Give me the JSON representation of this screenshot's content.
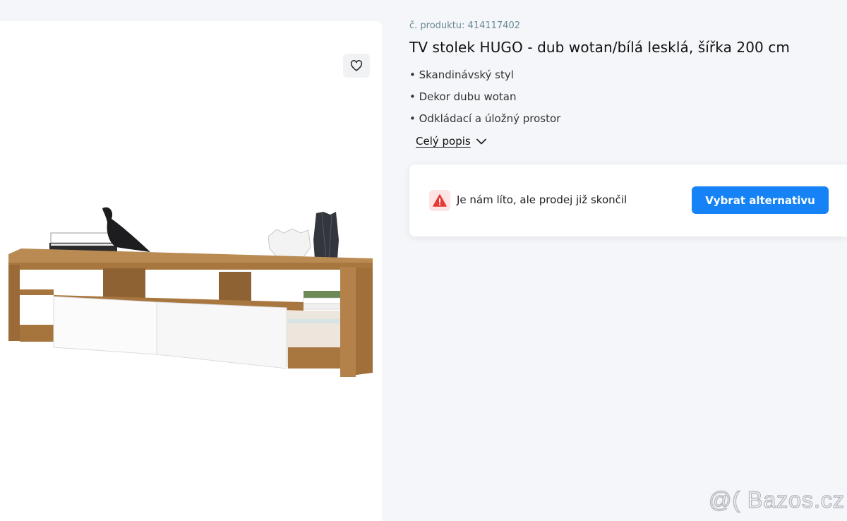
{
  "product": {
    "code_label": "č. produktu: 414117402",
    "title": "TV stolek HUGO - dub wotan/bílá lesklá, šířka 200 cm",
    "features": [
      "• Skandinávský styl",
      "• Dekor dubu wotan",
      "• Odkládací a úložný prostor"
    ],
    "full_description_link": "Celý popis"
  },
  "sale_status": {
    "message": "Je nám líto, ale prodej již skončil",
    "button_label": "Vybrat alternativu"
  },
  "icons": {
    "favorite": "heart-icon",
    "expand": "chevron-down-icon",
    "warning": "warning-triangle-icon"
  },
  "watermark": "@( Bazos.cz",
  "colors": {
    "accent": "#1582f5",
    "warning": "#e53935",
    "background": "#f4f6f9"
  }
}
